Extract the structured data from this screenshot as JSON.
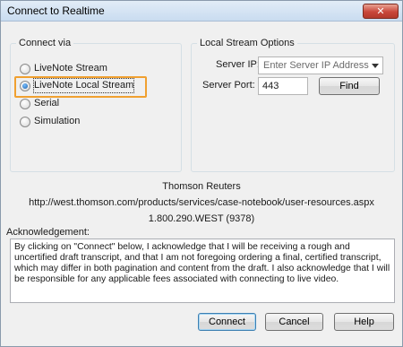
{
  "window": {
    "title": "Connect to Realtime",
    "close_label": "✕"
  },
  "connect_via": {
    "legend": "Connect via",
    "options": [
      {
        "label": "LiveNote Stream",
        "selected": false
      },
      {
        "label": "LiveNote Local Stream",
        "selected": true
      },
      {
        "label": "Serial",
        "selected": false
      },
      {
        "label": "Simulation",
        "selected": false
      }
    ]
  },
  "local_stream": {
    "legend": "Local Stream Options",
    "server_ip_label": "Server IP:",
    "server_ip_value": "Enter Server IP Address",
    "server_port_label": "Server Port:",
    "server_port_value": "443",
    "find_label": "Find"
  },
  "info": {
    "company": "Thomson Reuters",
    "url": "http://west.thomson.com/products/services/case-notebook/user-resources.aspx",
    "phone": "1.800.290.WEST (9378)"
  },
  "acknowledgement": {
    "label": "Acknowledgement:",
    "text": "By clicking on \"Connect\" below, I acknowledge that I will be receiving a rough and uncertified draft transcript, and that I am not foregoing ordering a final, certified transcript, which may differ in both pagination and content from the draft.  I also acknowledge that I will be responsible for any applicable fees associated with connecting to live video."
  },
  "buttons": {
    "connect": "Connect",
    "cancel": "Cancel",
    "help": "Help"
  },
  "colors": {
    "highlight": "#f0a030",
    "close_button": "#c9463a"
  }
}
